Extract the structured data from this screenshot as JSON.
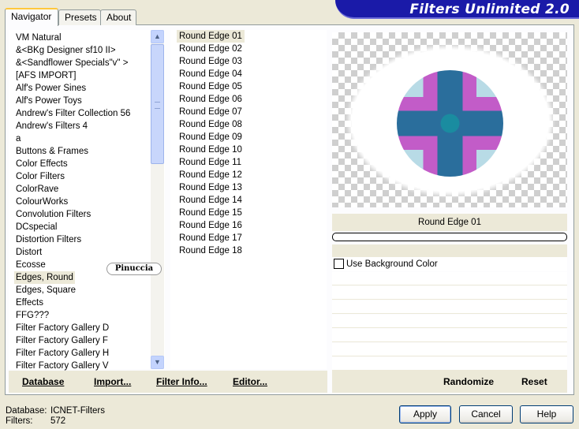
{
  "tabs": [
    {
      "label": "Navigator",
      "active": true
    },
    {
      "label": "Presets",
      "active": false
    },
    {
      "label": "About",
      "active": false
    }
  ],
  "banner": {
    "title": "Filters Unlimited 2.0"
  },
  "categories": {
    "items": [
      "VM Natural",
      "&<BKg Designer sf10 II>",
      "&<Sandflower Specials\"v\" >",
      "[AFS IMPORT]",
      "Alf's Power Sines",
      "Alf's Power Toys",
      "Andrew's Filter Collection 56",
      "Andrew's Filters 4",
      "a",
      "Buttons & Frames",
      "Color Effects",
      "Color Filters",
      "ColorRave",
      "ColourWorks",
      "Convolution Filters",
      "DCspecial",
      "Distortion Filters",
      "Distort",
      "Ecosse",
      "Edges, Round",
      "Edges, Square",
      "Effects",
      "FFG???",
      "Filter Factory Gallery D",
      "Filter Factory Gallery F",
      "Filter Factory Gallery H",
      "Filter Factory Gallery V"
    ],
    "selected": "Edges, Round"
  },
  "filters": {
    "items": [
      "Round Edge 01",
      "Round Edge 02",
      "Round Edge 03",
      "Round Edge 04",
      "Round Edge 05",
      "Round Edge 06",
      "Round Edge 07",
      "Round Edge 08",
      "Round Edge 09",
      "Round Edge 10",
      "Round Edge 11",
      "Round Edge 12",
      "Round Edge 13",
      "Round Edge 14",
      "Round Edge 15",
      "Round Edge 16",
      "Round Edge 17",
      "Round Edge 18"
    ],
    "selected": "Round Edge 01"
  },
  "watermark": "Pinuccia",
  "preview": {
    "filter_name": "Round Edge 01"
  },
  "options": {
    "use_bg_color_label": "Use Background Color",
    "use_bg_color_checked": false
  },
  "actions": {
    "database": "Database",
    "import": "Import...",
    "filter_info": "Filter Info...",
    "editor": "Editor...",
    "randomize": "Randomize",
    "reset": "Reset"
  },
  "footer": {
    "database_label": "Database:",
    "database_value": "ICNET-Filters",
    "filters_label": "Filters:",
    "filters_value": "572"
  },
  "buttons": {
    "apply": "Apply",
    "cancel": "Cancel",
    "help": "Help"
  }
}
